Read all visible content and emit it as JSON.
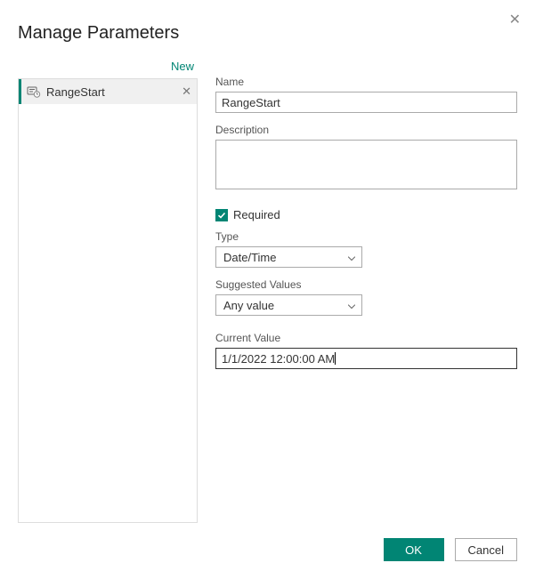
{
  "dialog": {
    "title": "Manage Parameters",
    "new_link": "New",
    "ok_label": "OK",
    "cancel_label": "Cancel"
  },
  "sidebar": {
    "items": [
      {
        "label": "RangeStart"
      }
    ]
  },
  "form": {
    "name_label": "Name",
    "name_value": "RangeStart",
    "description_label": "Description",
    "description_value": "",
    "required_label": "Required",
    "type_label": "Type",
    "type_value": "Date/Time",
    "suggested_label": "Suggested Values",
    "suggested_value": "Any value",
    "current_value_label": "Current Value",
    "current_value": "1/1/2022 12:00:00 AM"
  }
}
